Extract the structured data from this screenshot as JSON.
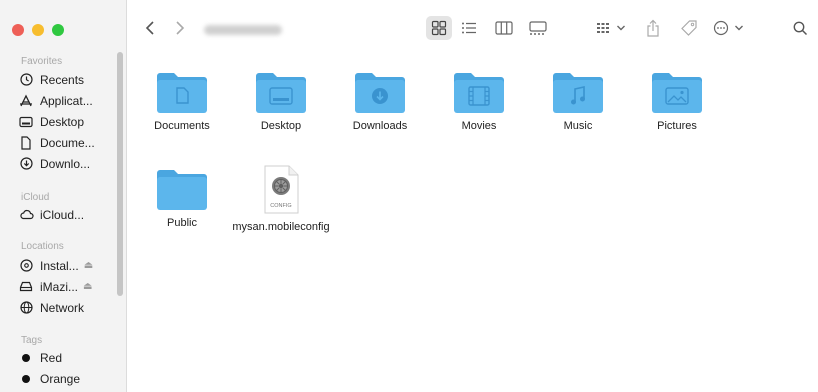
{
  "window": {
    "traffic_lights": [
      {
        "name": "close",
        "color": "#ee5f57"
      },
      {
        "name": "minimize",
        "color": "#f7bd2e"
      },
      {
        "name": "zoom",
        "color": "#2fc840"
      }
    ]
  },
  "toolbar": {
    "back_icon": "chevron-left-icon",
    "forward_icon": "chevron-right-icon",
    "path_title_blurred": true,
    "view_modes": [
      "icon-view",
      "list-view",
      "column-view",
      "gallery-view"
    ],
    "active_view": "icon-view"
  },
  "sidebar": {
    "sections": [
      {
        "title": "Favorites",
        "items": [
          {
            "label": "Recents",
            "icon": "clock-icon"
          },
          {
            "label": "Applicat...",
            "icon": "applications-icon"
          },
          {
            "label": "Desktop",
            "icon": "desktop-icon"
          },
          {
            "label": "Docume...",
            "icon": "document-icon"
          },
          {
            "label": "Downlo...",
            "icon": "download-icon"
          }
        ]
      },
      {
        "title": "iCloud",
        "items": [
          {
            "label": "iCloud...",
            "icon": "cloud-icon"
          }
        ]
      },
      {
        "title": "Locations",
        "items": [
          {
            "label": "Instal...",
            "icon": "disk-icon",
            "eject": true
          },
          {
            "label": "iMazi...",
            "icon": "external-drive-icon",
            "eject": true
          },
          {
            "label": "Network",
            "icon": "globe-icon"
          }
        ]
      },
      {
        "title": "Tags",
        "items": [
          {
            "label": "Red",
            "icon": "tag-dot-icon",
            "color": "#111111"
          },
          {
            "label": "Orange",
            "icon": "tag-dot-icon",
            "color": "#111111"
          }
        ]
      }
    ]
  },
  "files": [
    {
      "label": "Documents",
      "kind": "folder",
      "glyph": "document"
    },
    {
      "label": "Desktop",
      "kind": "folder",
      "glyph": "desktop"
    },
    {
      "label": "Downloads",
      "kind": "folder",
      "glyph": "download"
    },
    {
      "label": "Movies",
      "kind": "folder",
      "glyph": "film"
    },
    {
      "label": "Music",
      "kind": "folder",
      "glyph": "music"
    },
    {
      "label": "Pictures",
      "kind": "folder",
      "glyph": "photo"
    },
    {
      "label": "Public",
      "kind": "folder",
      "glyph": "none"
    },
    {
      "label": "mysan.mobileconfig",
      "kind": "config",
      "badge": "CONFIG"
    }
  ],
  "colors": {
    "folder_body": "#5cb6ec",
    "folder_tab": "#4aa6e0",
    "folder_glyph": "#3a93cf",
    "sidebar_bg": "#f3f3f3"
  }
}
